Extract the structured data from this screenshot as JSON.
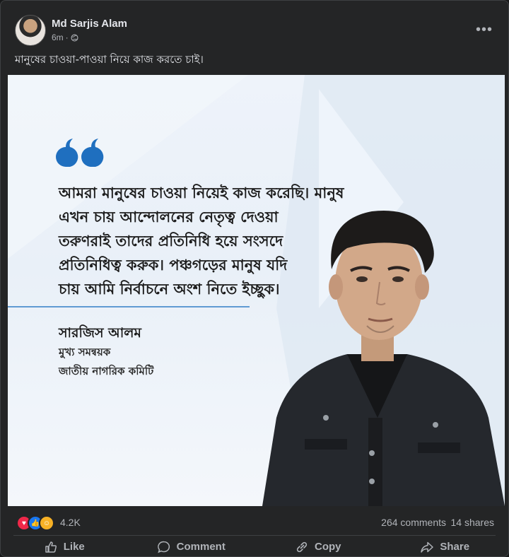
{
  "post": {
    "author": "Md Sarjis Alam",
    "time": "6m",
    "dot": "·",
    "caption": "মানুষের চাওয়া-পাওয়া নিয়ে কাজ করতে চাই।",
    "more_label": "•••"
  },
  "image": {
    "quote_lines": [
      "আমরা মানুষের চাওয়া নিয়েই কাজ করেছি। মানুষ",
      "এখন চায় আন্দোলনের নেতৃত্ব দেওয়া",
      "তরুণরাই তাদের প্রতিনিধি হয়ে সংসদে",
      "প্রতিনিধিত্ব করুক। পঞ্চগড়ের মানুষ যদি",
      "চায় আমি নির্বাচনে অংশ নিতে ইচ্ছুক।"
    ],
    "signature_name": "সারজিস আলম",
    "signature_role": "মুখ্য সমন্বয়ক",
    "signature_org": "জাতীয় নাগরিক কমিটি",
    "accent_color": "#1f6fbf"
  },
  "stats": {
    "reactions": "4.2K",
    "comments": "264 comments",
    "shares": "14 shares"
  },
  "actions": {
    "like": "Like",
    "comment": "Comment",
    "copy": "Copy",
    "share": "Share"
  }
}
